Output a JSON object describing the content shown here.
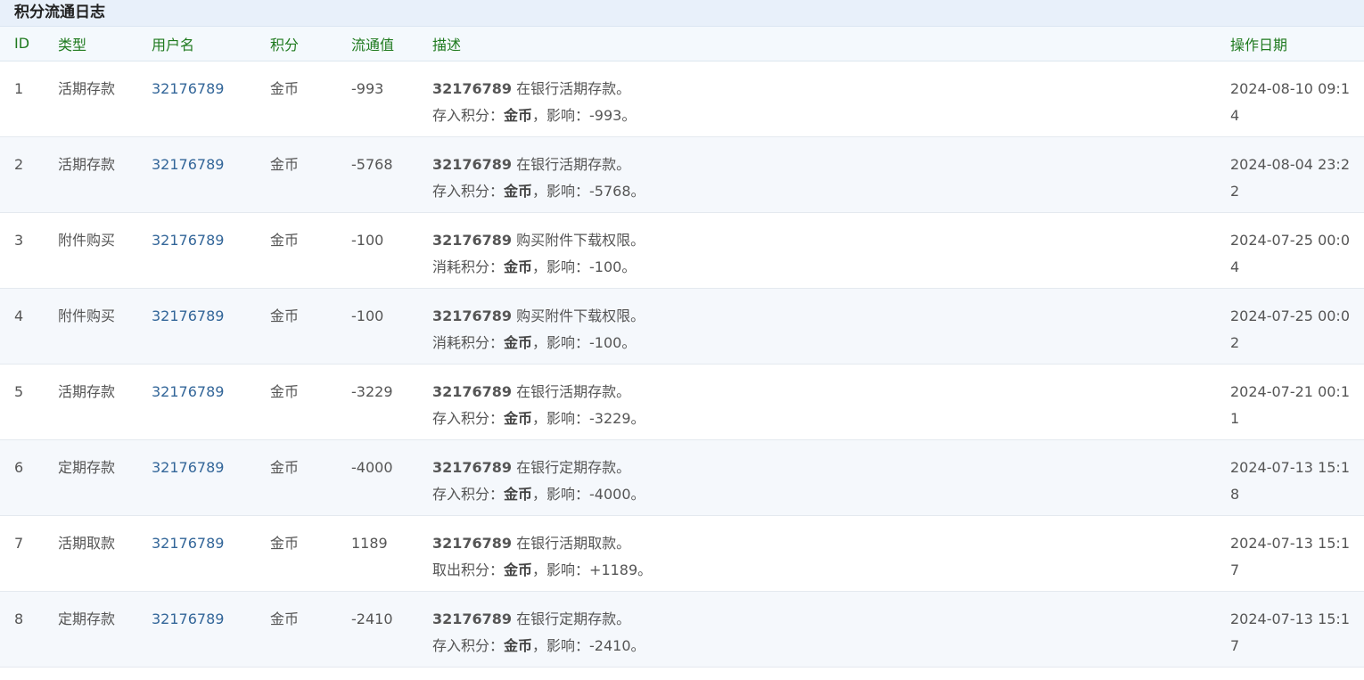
{
  "panel": {
    "title": "积分流通日志"
  },
  "columns": {
    "id": "ID",
    "type": "类型",
    "user": "用户名",
    "credit": "积分",
    "value": "流通值",
    "desc": "描述",
    "date": "操作日期"
  },
  "rows": [
    {
      "id": "1",
      "type": "活期存款",
      "user": "32176789",
      "credit": "金币",
      "value": "-993",
      "desc_user": "32176789",
      "desc_action": " 在银行活期存款。",
      "desc_prefix": "存入积分：",
      "desc_credit": "金币",
      "desc_effect": "，影响：-993。",
      "date": "2024-08-10 09:14"
    },
    {
      "id": "2",
      "type": "活期存款",
      "user": "32176789",
      "credit": "金币",
      "value": "-5768",
      "desc_user": "32176789",
      "desc_action": " 在银行活期存款。",
      "desc_prefix": "存入积分：",
      "desc_credit": "金币",
      "desc_effect": "，影响：-5768。",
      "date": "2024-08-04 23:22"
    },
    {
      "id": "3",
      "type": "附件购买",
      "user": "32176789",
      "credit": "金币",
      "value": "-100",
      "desc_user": "32176789",
      "desc_action": " 购买附件下载权限。",
      "desc_prefix": "消耗积分：",
      "desc_credit": "金币",
      "desc_effect": "，影响：-100。",
      "date": "2024-07-25 00:04"
    },
    {
      "id": "4",
      "type": "附件购买",
      "user": "32176789",
      "credit": "金币",
      "value": "-100",
      "desc_user": "32176789",
      "desc_action": " 购买附件下载权限。",
      "desc_prefix": "消耗积分：",
      "desc_credit": "金币",
      "desc_effect": "，影响：-100。",
      "date": "2024-07-25 00:02"
    },
    {
      "id": "5",
      "type": "活期存款",
      "user": "32176789",
      "credit": "金币",
      "value": "-3229",
      "desc_user": "32176789",
      "desc_action": " 在银行活期存款。",
      "desc_prefix": "存入积分：",
      "desc_credit": "金币",
      "desc_effect": "，影响：-3229。",
      "date": "2024-07-21 00:11"
    },
    {
      "id": "6",
      "type": "定期存款",
      "user": "32176789",
      "credit": "金币",
      "value": "-4000",
      "desc_user": "32176789",
      "desc_action": " 在银行定期存款。",
      "desc_prefix": "存入积分：",
      "desc_credit": "金币",
      "desc_effect": "，影响：-4000。",
      "date": "2024-07-13 15:18"
    },
    {
      "id": "7",
      "type": "活期取款",
      "user": "32176789",
      "credit": "金币",
      "value": "1189",
      "desc_user": "32176789",
      "desc_action": " 在银行活期取款。",
      "desc_prefix": "取出积分：",
      "desc_credit": "金币",
      "desc_effect": "，影响：+1189。",
      "date": "2024-07-13 15:17"
    },
    {
      "id": "8",
      "type": "定期存款",
      "user": "32176789",
      "credit": "金币",
      "value": "-2410",
      "desc_user": "32176789",
      "desc_action": " 在银行定期存款。",
      "desc_prefix": "存入积分：",
      "desc_credit": "金币",
      "desc_effect": "，影响：-2410。",
      "date": "2024-07-13 15:17"
    }
  ]
}
